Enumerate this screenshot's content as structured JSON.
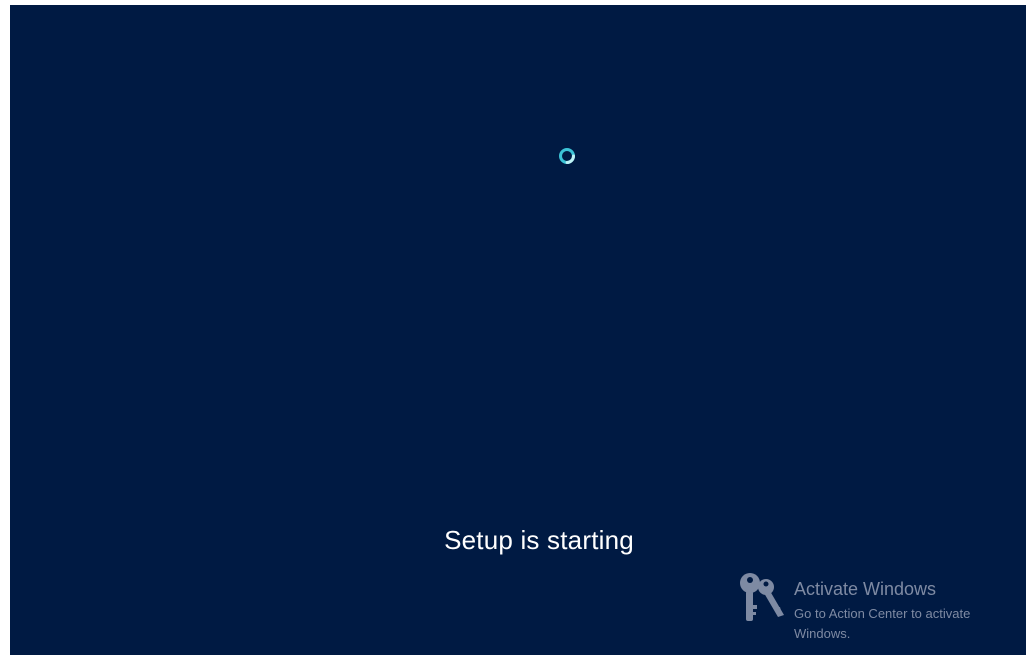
{
  "setup": {
    "status_text": "Setup is starting"
  },
  "spinner": {
    "icon": "loading-ring-icon",
    "color": "#3cc3d6"
  },
  "watermark": {
    "icon": "keys-icon",
    "title": "Activate Windows",
    "subtitle": "Go to Action Center to activate Windows."
  },
  "colors": {
    "background": "#001a43",
    "text": "#ffffff",
    "watermark_text": "#7e8aa3"
  }
}
